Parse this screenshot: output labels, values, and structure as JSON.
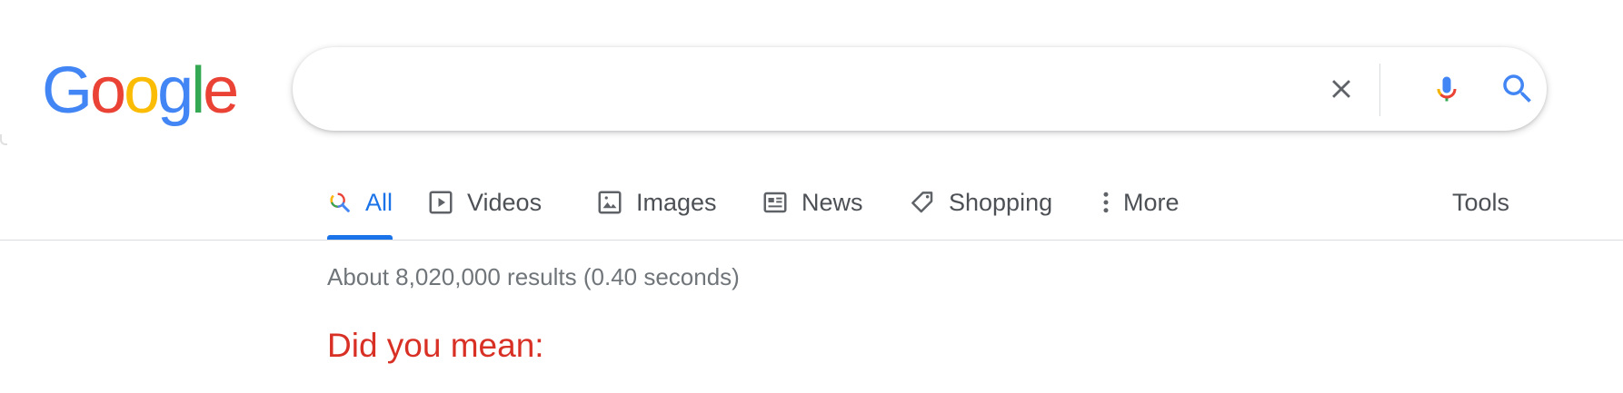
{
  "logo": {
    "letters": [
      "G",
      "o",
      "o",
      "g",
      "l",
      "e"
    ],
    "colors": [
      "#4285F4",
      "#EA4335",
      "#FBBC05",
      "#4285F4",
      "#34A853",
      "#EA4335"
    ]
  },
  "search": {
    "query": "",
    "placeholder": ""
  },
  "tabs": [
    {
      "label": "All",
      "icon": "search-icon",
      "active": true
    },
    {
      "label": "Videos",
      "icon": "play-icon",
      "active": false
    },
    {
      "label": "Images",
      "icon": "image-icon",
      "active": false
    },
    {
      "label": "News",
      "icon": "news-icon",
      "active": false
    },
    {
      "label": "Shopping",
      "icon": "tag-icon",
      "active": false
    },
    {
      "label": "More",
      "icon": "more-vert-icon",
      "active": false
    }
  ],
  "tools_label": "Tools",
  "result_stats": "About 8,020,000 results (0.40 seconds)",
  "did_you_mean": "Did you mean:",
  "colors": {
    "accent": "#1a73e8",
    "did_you_mean": "#d93025",
    "muted": "#70757a",
    "text": "#4d5156"
  }
}
